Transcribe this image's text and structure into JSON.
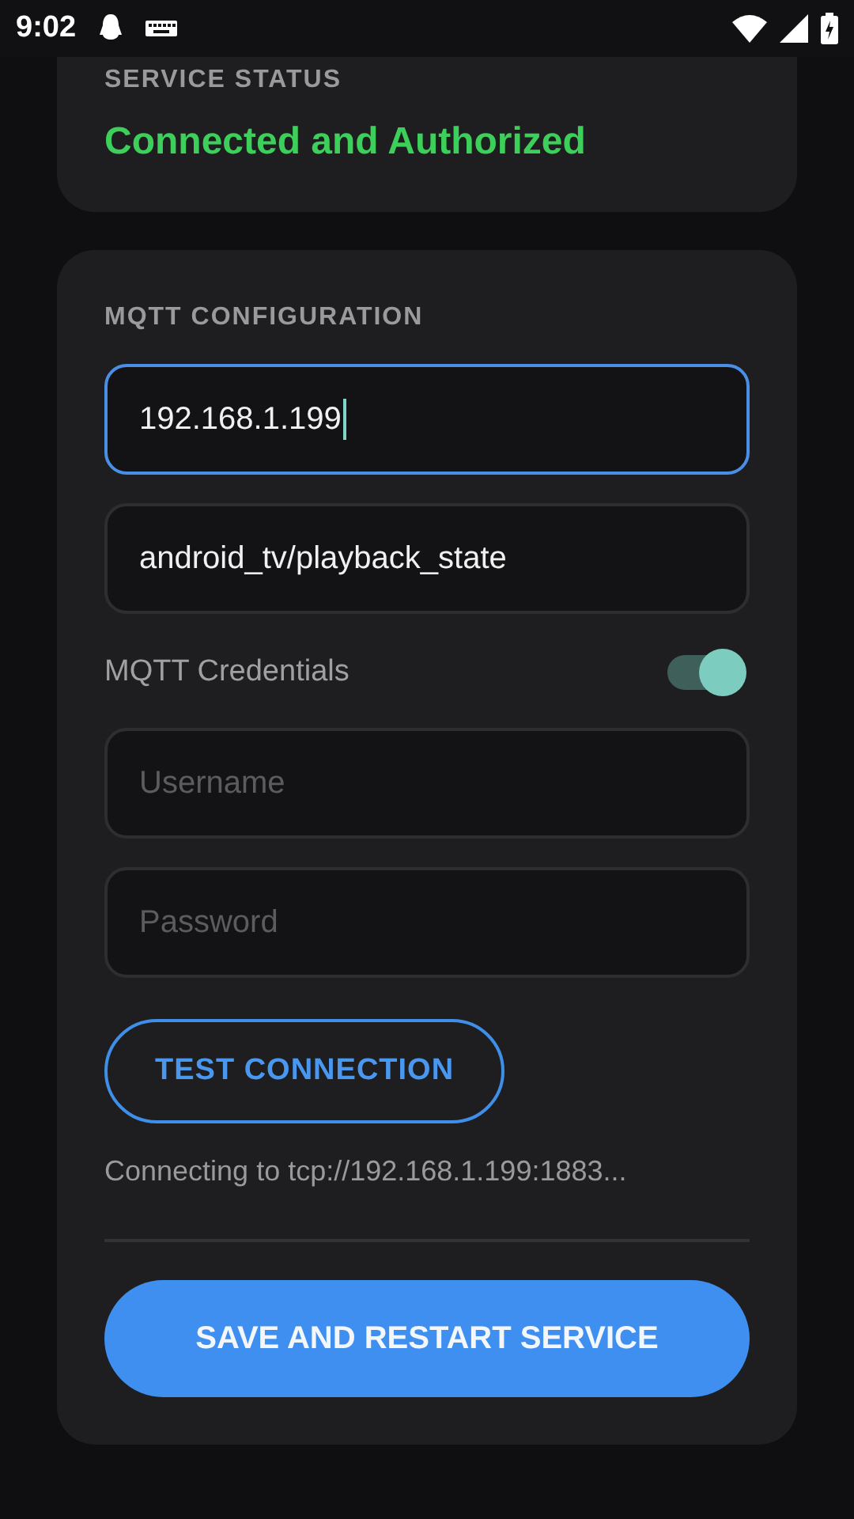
{
  "status_bar": {
    "time": "9:02"
  },
  "service_status": {
    "label": "SERVICE STATUS",
    "value": "Connected and Authorized"
  },
  "mqtt": {
    "heading": "MQTT CONFIGURATION",
    "fields": [
      {
        "value": "192.168.1.199",
        "focused": true
      },
      {
        "value": "android_tv/playback_state",
        "focused": false
      }
    ],
    "credentials": {
      "label": "MQTT Credentials",
      "on": true
    },
    "credential_fields": [
      {
        "placeholder": "Username",
        "focused": false
      },
      {
        "placeholder": "Password",
        "focused": false
      }
    ],
    "test_button": "TEST CONNECTION",
    "connection_message": "Connecting to tcp://192.168.1.199:1883...",
    "save_button": "SAVE AND RESTART SERVICE"
  }
}
